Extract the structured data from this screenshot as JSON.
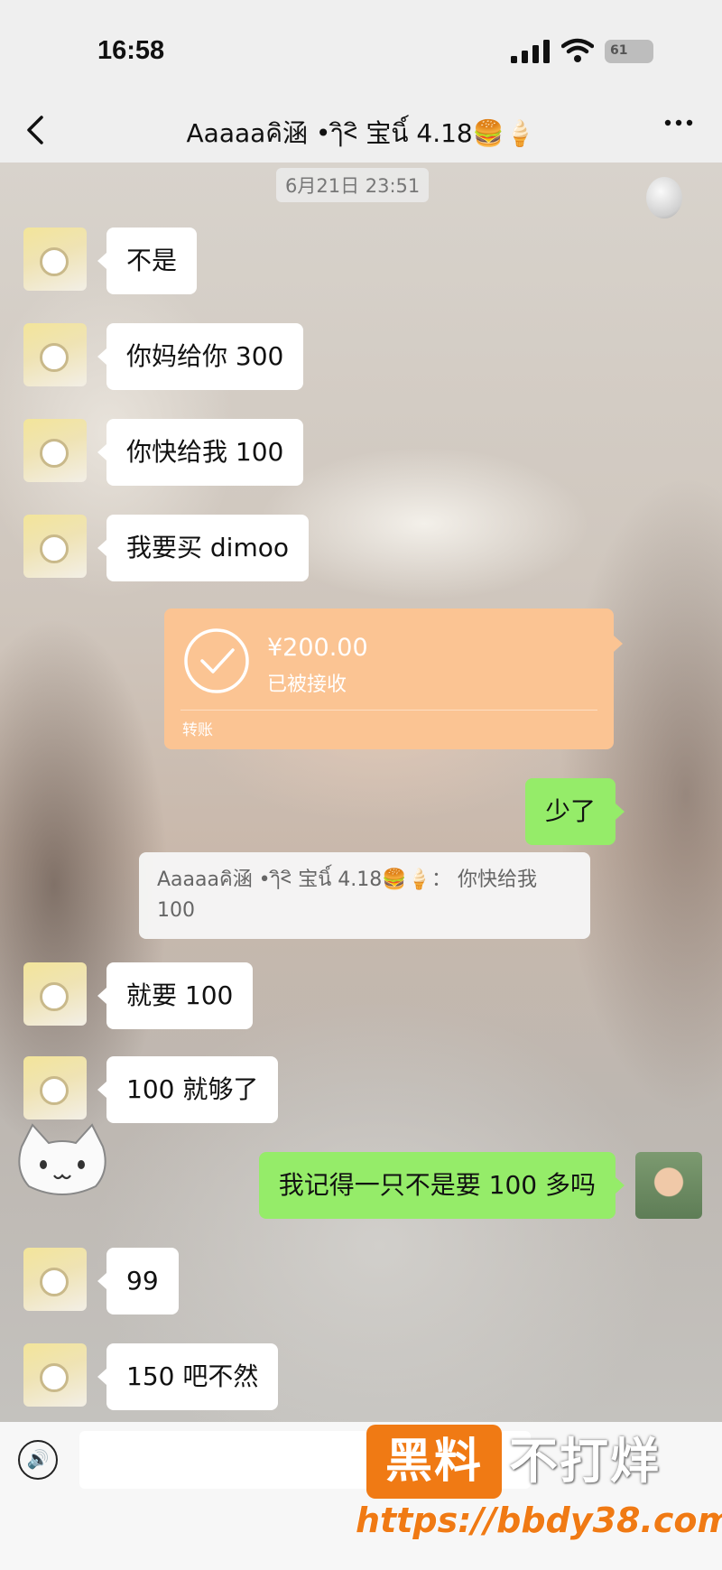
{
  "status_bar": {
    "time": "16:58",
    "battery": "61"
  },
  "header": {
    "back_icon": "chevron-left-icon",
    "title": "Aaaaaคิ涵 •ๅิ<ิ 宝นิ์ 4.18🍔🍦",
    "more_icon": "ellipsis-icon"
  },
  "timestamp": "6月21日 23:51",
  "messages": [
    {
      "side": "left",
      "text": "不是"
    },
    {
      "side": "left",
      "text": "你妈给你 300"
    },
    {
      "side": "left",
      "text": "你快给我 100"
    },
    {
      "side": "left",
      "text": "我要买 dimoo"
    },
    {
      "side": "right",
      "text": "少了"
    },
    {
      "side": "left",
      "text": "就要 100"
    },
    {
      "side": "left",
      "text": "100 就够了"
    },
    {
      "side": "right",
      "text": "我记得一只不是要 100 多吗"
    },
    {
      "side": "left",
      "text": "99"
    },
    {
      "side": "left",
      "text": "150 吧不然"
    }
  ],
  "transfer": {
    "amount": "¥200.00",
    "status": "已被接收",
    "label": "转账",
    "icon": "check-circle-icon"
  },
  "quote": {
    "text": "Aaaaaคิ涵 •ๅิ<ิ 宝นิ์ 4.18🍔🍦： 你快给我 100"
  },
  "input_bar": {
    "voice_icon": "voice-icon"
  },
  "watermark": {
    "box_text": "黑料",
    "text": "不打烊",
    "url": "https://bbdy38.com"
  },
  "colors": {
    "bubble_left": "#ffffff",
    "bubble_right": "#95ec69",
    "transfer": "#fbc493",
    "watermark": "#f07a14"
  }
}
